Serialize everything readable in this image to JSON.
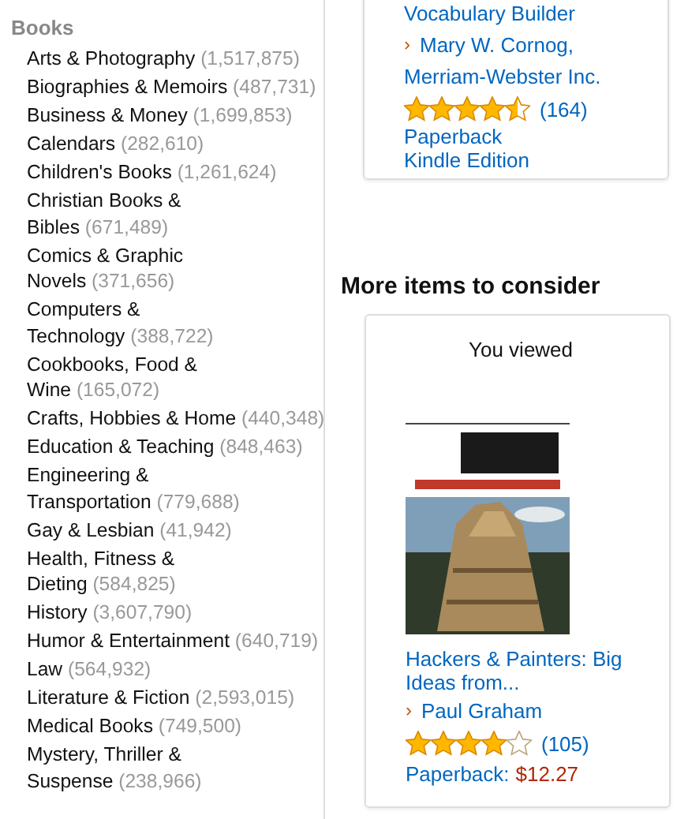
{
  "sidebar": {
    "heading": "Books",
    "categories": [
      {
        "name": "Arts & Photography",
        "count": "(1,517,875)"
      },
      {
        "name": "Biographies & Memoirs",
        "count": "(487,731)"
      },
      {
        "name": "Business & Money",
        "count": "(1,699,853)"
      },
      {
        "name": "Calendars",
        "count": "(282,610)"
      },
      {
        "name": "Children's Books",
        "count": "(1,261,624)"
      },
      {
        "name": "Christian Books & Bibles",
        "count": "(671,489)"
      },
      {
        "name": "Comics & Graphic Novels",
        "count": "(371,656)"
      },
      {
        "name": "Computers & Technology",
        "count": "(388,722)"
      },
      {
        "name": "Cookbooks, Food & Wine",
        "count": "(165,072)"
      },
      {
        "name": "Crafts, Hobbies & Home",
        "count": "(440,348)"
      },
      {
        "name": "Education & Teaching",
        "count": "(848,463)"
      },
      {
        "name": "Engineering & Transportation",
        "count": "(779,688)"
      },
      {
        "name": "Gay & Lesbian",
        "count": "(41,942)"
      },
      {
        "name": "Health, Fitness & Dieting",
        "count": "(584,825)"
      },
      {
        "name": "History",
        "count": "(3,607,790)"
      },
      {
        "name": "Humor & Entertainment",
        "count": "(640,719)"
      },
      {
        "name": "Law",
        "count": "(564,932)"
      },
      {
        "name": "Literature & Fiction",
        "count": "(2,593,015)"
      },
      {
        "name": "Medical Books",
        "count": "(749,500)"
      },
      {
        "name": "Mystery, Thriller & Suspense",
        "count": "(238,966)"
      }
    ]
  },
  "top_card": {
    "title": "Vocabulary Builder",
    "caret": "›",
    "authors": [
      "Mary W. Cornog,",
      "Merriam-Webster Inc."
    ],
    "stars": 4.5,
    "reviews": "(164)",
    "formats": [
      "Paperback",
      "Kindle Edition"
    ]
  },
  "more_items": {
    "heading": "More items to consider",
    "card": {
      "label": "You viewed",
      "title": "Hackers & Painters: Big Ideas from...",
      "caret": "›",
      "author": "Paul Graham",
      "stars": 4,
      "reviews": "(105)",
      "format": "Paperback:",
      "price": "$12.27"
    }
  }
}
